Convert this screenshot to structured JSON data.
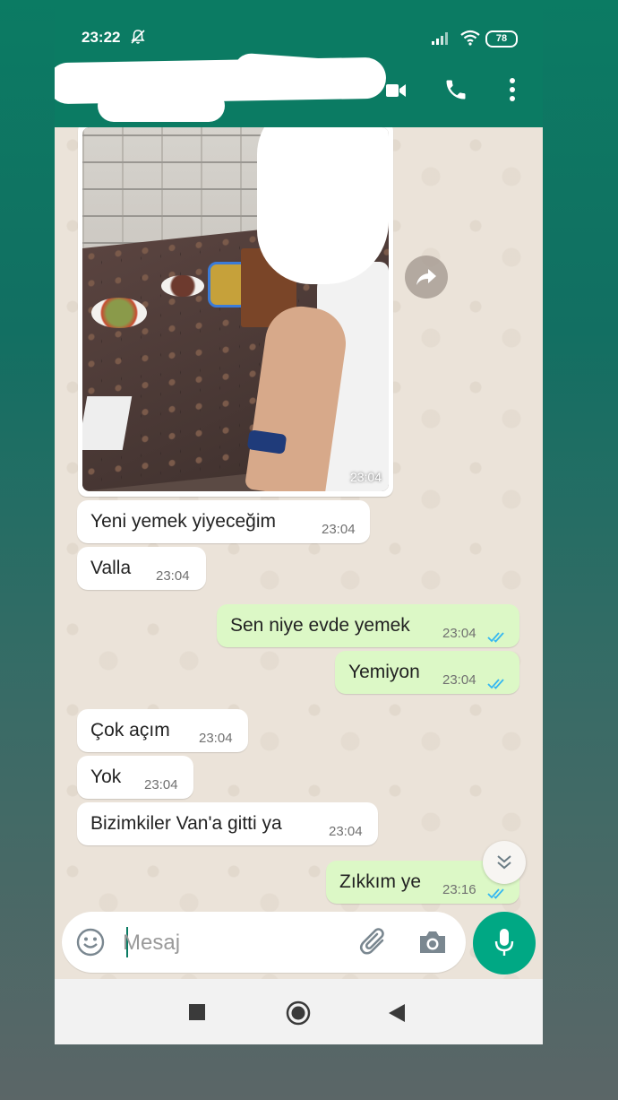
{
  "status_bar": {
    "time": "23:22",
    "battery": "78"
  },
  "photo_message": {
    "time": "23:04"
  },
  "messages": [
    {
      "text": "Yeni yemek yiyeceğim",
      "time": "23:04"
    },
    {
      "text": "Valla",
      "time": "23:04"
    },
    {
      "text": "Sen niye evde yemek",
      "time": "23:04"
    },
    {
      "text": "Yemiyon",
      "time": "23:04"
    },
    {
      "text": "Çok açım",
      "time": "23:04"
    },
    {
      "text": "Yok",
      "time": "23:04"
    },
    {
      "text": "Bizimkiler Van'a gitti ya",
      "time": "23:04"
    },
    {
      "text": "Zıkkım ye",
      "time": "23:16"
    }
  ],
  "composer": {
    "placeholder": "Mesaj"
  },
  "colors": {
    "header": "#0b7b63",
    "outgoing_bubble": "#dcf8c6",
    "incoming_bubble": "#ffffff",
    "read_ticks": "#34b7f1",
    "mic_button": "#00a884",
    "chat_background": "#ebe3d9"
  },
  "icons": [
    "bell-off-icon",
    "signal-icon",
    "wifi-icon",
    "video-call-icon",
    "phone-icon",
    "more-vert-icon",
    "forward-icon",
    "double-check-icon",
    "chevrons-down-icon",
    "emoji-icon",
    "attach-icon",
    "camera-icon",
    "mic-icon",
    "nav-square-icon",
    "nav-circle-icon",
    "nav-back-icon"
  ]
}
